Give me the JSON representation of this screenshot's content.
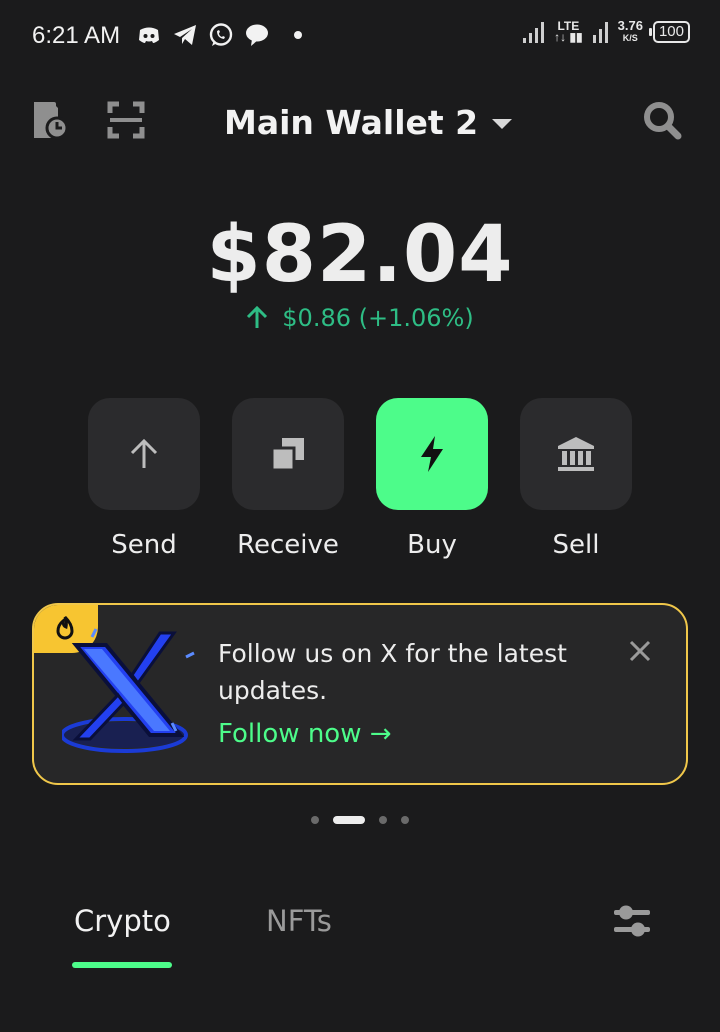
{
  "status_bar": {
    "time": "6:21 AM",
    "network": "LTE",
    "speed_value": "3.76",
    "speed_unit": "K/S",
    "battery": "100"
  },
  "header": {
    "wallet_name": "Main Wallet 2",
    "icons": [
      "history-icon",
      "scan-icon",
      "search-icon"
    ]
  },
  "balance": {
    "amount": "$82.04",
    "change": "$0.86 (+1.06%)",
    "change_direction": "up",
    "change_color": "#2ebd85"
  },
  "actions": [
    {
      "label": "Send",
      "icon": "arrow-up-icon"
    },
    {
      "label": "Receive",
      "icon": "copy-icon"
    },
    {
      "label": "Buy",
      "icon": "lightning-icon"
    },
    {
      "label": "Sell",
      "icon": "bank-icon"
    }
  ],
  "banner": {
    "text": "Follow us on X for the latest updates.",
    "link": "Follow now →",
    "border_color": "#f0c74a",
    "link_color": "#4dfc8a"
  },
  "pager": {
    "count": 4,
    "active": 1
  },
  "tabs": [
    {
      "label": "Crypto",
      "active": true
    },
    {
      "label": "NFTs",
      "active": false
    }
  ],
  "colors": {
    "background": "#1b1b1c",
    "accent": "#4dfc8a",
    "tile": "#2b2b2d"
  }
}
